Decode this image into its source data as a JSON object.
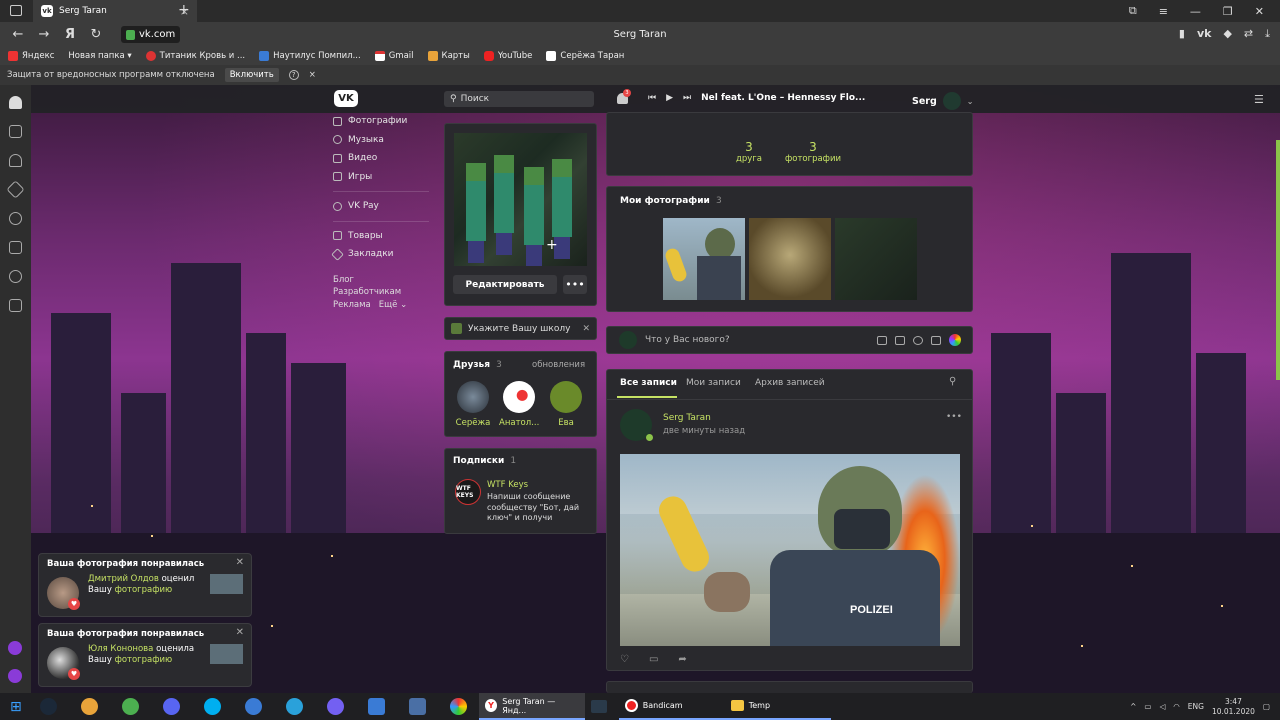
{
  "browser": {
    "tab_title": "Serg Taran",
    "url": "vk.com",
    "page_title": "Serg Taran",
    "bookmarks": [
      "Яндекс",
      "Новая папка ▾",
      "Титаник Кровь и ...",
      "Наутилус Помпил...",
      "Gmail",
      "Карты",
      "YouTube",
      "Серёжа Таран"
    ],
    "protection_notice": "Защита от вредоносных программ отключена",
    "enable_label": "Включить"
  },
  "vk_header": {
    "logo": "VK",
    "search_placeholder": "Поиск",
    "notif_count": "3",
    "track": "Nel feat. L'One – Hennessy Flo...",
    "username": "Serg"
  },
  "left_nav": {
    "items": [
      "Фотографии",
      "Музыка",
      "Видео",
      "Игры",
      "VK Pay",
      "Товары",
      "Закладки"
    ],
    "footer": [
      "Блог",
      "Разработчикам",
      "Реклама",
      "Ещё ⌄"
    ]
  },
  "profile": {
    "edit_label": "Редактировать",
    "more_label": "•••",
    "school_prompt": "Укажите Вашу школу",
    "friends_title": "Друзья",
    "friends_count": "3",
    "friends_updates": "обновления",
    "friends": [
      "Серёжа",
      "Анатол...",
      "Ева"
    ],
    "subs_title": "Подписки",
    "subs_count": "1",
    "sub_name": "WTF Keys",
    "sub_logo": "WTF KEYS",
    "sub_desc": "Напиши сообщение сообществу \"Бот, дай ключ\" и получи",
    "counts": [
      {
        "num": "3",
        "label": "друга"
      },
      {
        "num": "3",
        "label": "фотографии"
      }
    ],
    "photos_title": "Мои фотографии",
    "photos_count": "3",
    "composer_placeholder": "Что у Вас нового?",
    "wall_tabs": [
      "Все записи",
      "Мои записи",
      "Архив записей"
    ],
    "post_author": "Serg Taran",
    "post_time": "две минуты назад",
    "post_badge": "POLIZEI"
  },
  "notifications": [
    {
      "title": "Ваша фотография понравилась",
      "name": "Дмитрий Олдов",
      "action": " оценил",
      "prefix": "Вашу ",
      "link": "фотографию"
    },
    {
      "title": "Ваша фотография понравилась",
      "name": "Юля Кононова",
      "action": " оценила",
      "prefix": "Вашу ",
      "link": "фотографию"
    }
  ],
  "taskbar": {
    "tasks": [
      "Serg Taran — Янд...",
      "Bandicam",
      "Temp"
    ],
    "lang": "ENG",
    "time": "3:47",
    "date": "10.01.2020"
  },
  "colors": {
    "accent": "#c6e264",
    "card": "#29292d",
    "header": "#222226"
  }
}
